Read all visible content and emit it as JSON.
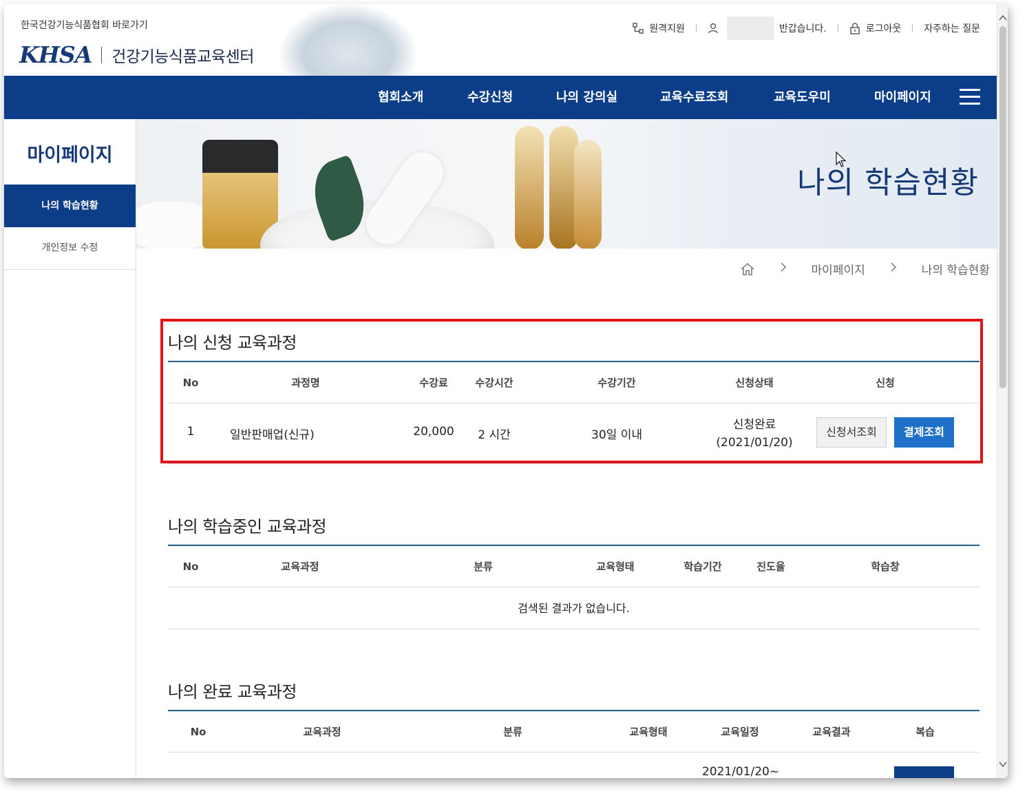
{
  "header": {
    "assoc_link": "한국건강기능식품협회 바로가기",
    "logo_mark": "KHSA",
    "logo_text": "건강기능식품교육센터",
    "util": {
      "remote": "원격지원",
      "greeting": "반갑습니다.",
      "logout": "로그아웃",
      "faq": "자주하는 질문"
    }
  },
  "nav": {
    "items": [
      "협회소개",
      "수강신청",
      "나의 강의실",
      "교육수료조회",
      "교육도우미",
      "마이페이지"
    ]
  },
  "sidebar": {
    "title": "마이페이지",
    "items": [
      {
        "label": "나의 학습현황"
      },
      {
        "label": "개인정보 수정"
      }
    ]
  },
  "banner": {
    "title": "나의 학습현황"
  },
  "breadcrumb": [
    "마이페이지",
    "나의 학습현황"
  ],
  "applied": {
    "title": "나의 신청 교육과정",
    "columns": [
      "No",
      "과정명",
      "수강료",
      "수강시간",
      "수강기간",
      "신청상태",
      "신청"
    ],
    "rows": [
      {
        "no": "1",
        "course": "일반판매업(신규)",
        "fee": "20,000",
        "hours": "2 시간",
        "period": "30일 이내",
        "status": "신청완료",
        "status_date": "(2021/01/20)",
        "btn_view": "신청서조회",
        "btn_pay": "결제조회"
      }
    ]
  },
  "inprogress": {
    "title": "나의 학습중인 교육과정",
    "columns": [
      "No",
      "교육과정",
      "분류",
      "교육형태",
      "학습기간",
      "진도율",
      "학습창"
    ],
    "empty_text": "검색된 결과가 없습니다."
  },
  "completed": {
    "title": "나의 완료 교육과정",
    "columns": [
      "No",
      "교육과정",
      "분류",
      "교육형태",
      "교육일정",
      "교육결과",
      "복습"
    ],
    "partial_date": "2021/01/20~"
  },
  "colors": {
    "navy": "#0c3d88",
    "button_blue": "#1e70c9",
    "highlight_red": "#e0141a"
  }
}
